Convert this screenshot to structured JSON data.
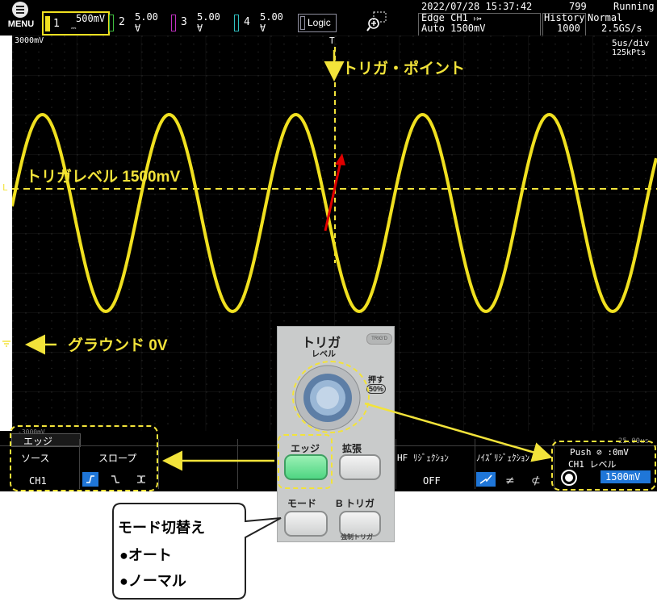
{
  "topbar": {
    "menu_label": "MENU",
    "channels": [
      {
        "num": "1",
        "value": "500mV",
        "color": "#f0e020"
      },
      {
        "num": "2",
        "value": "5.00 V",
        "color": "#40c040"
      },
      {
        "num": "3",
        "value": "5.00 V",
        "color": "#c030c0"
      },
      {
        "num": "4",
        "value": "5.00 V",
        "color": "#30c0c0"
      }
    ],
    "logic_label": "Logic",
    "datetime": "2022/07/28 15:37:42",
    "trigger_type": "Edge CH1 ⤠",
    "trigger_mode_level": "Auto 1500mV",
    "acq_count": "799",
    "run_state": "Running",
    "history_label": "History",
    "history_value": "1000",
    "acq_mode": "Normal",
    "sample_rate": "2.5GS/s"
  },
  "screen": {
    "top_left_label": "3000mV",
    "timebase": "5us/div",
    "record_points": "125kPts",
    "trigger_marker": "T",
    "level_marker": "L",
    "bottom_left_label": "-3000mV",
    "bottom_right_label": "25.00us",
    "waveform_color": "#f0e020"
  },
  "softkeys": {
    "menu_title": "エッジ",
    "source_label": "ソース",
    "source_value": "CH1",
    "slope_label": "スロープ",
    "hf_label": "HF ﾘｼﾞｪｸｼｮﾝ",
    "hf_value": "OFF",
    "noise_label": "ﾉｲｽﾞﾘｼﾞｪｸｼｮﾝ",
    "push_label": "Push ⊘ :0mV",
    "level_label": "CH1  レベル",
    "level_value": "1500mV"
  },
  "panel": {
    "title": "トリガ",
    "subtitle": "レベル",
    "trig_badge": "TRIG'D",
    "push_label": "押す",
    "fifty_label": "50%",
    "edge_key": "エッジ",
    "zoom_key": "拡張",
    "mode_key": "モード",
    "btrig_key": "B トリガ",
    "bottom_label": "強制トリガ"
  },
  "annotations": {
    "trigger_point": "トリガ・ポイント",
    "trigger_level": "トリガレベル  1500mV",
    "ground": "グラウンド  0V",
    "mode_switch_title": "モード切替え",
    "mode_auto": "●オート",
    "mode_normal": "●ノーマル"
  }
}
